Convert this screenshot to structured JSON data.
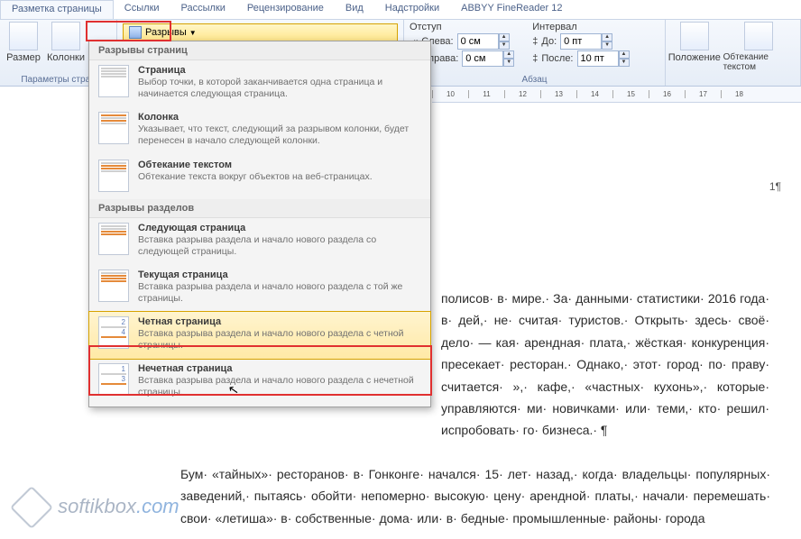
{
  "tabs": [
    "Разметка страницы",
    "Ссылки",
    "Рассылки",
    "Рецензирование",
    "Вид",
    "Надстройки",
    "ABBYY FineReader 12"
  ],
  "ribbon": {
    "size_label": "Размер",
    "columns_label": "Колонки",
    "page_params_label": "Параметры стран",
    "breaks_label": "Разрывы",
    "indent_title": "Отступ",
    "indent_left_label": "Слева:",
    "indent_right_label": "Справа:",
    "indent_left_val": "0 см",
    "indent_right_val": "0 см",
    "spacing_title": "Интервал",
    "spacing_before_label": "До:",
    "spacing_after_label": "После:",
    "spacing_before_val": "0 пт",
    "spacing_after_val": "10 пт",
    "paragraph_label": "Абзац",
    "position_label": "Положение",
    "wrap_label": "Обтекание текстом"
  },
  "menu": {
    "h1": "Разрывы страниц",
    "h2": "Разрывы разделов",
    "items_pages": [
      {
        "title": "Страница",
        "desc": "Выбор точки, в которой заканчивается одна страница и начинается следующая страница."
      },
      {
        "title": "Колонка",
        "desc": "Указывает, что текст, следующий за разрывом колонки, будет перенесен в начало следующей колонки."
      },
      {
        "title": "Обтекание текстом",
        "desc": "Обтекание текста вокруг объектов на веб-страницах."
      }
    ],
    "items_sections": [
      {
        "title": "Следующая страница",
        "desc": "Вставка разрыва раздела и начало нового раздела со следующей страницы."
      },
      {
        "title": "Текущая страница",
        "desc": "Вставка разрыва раздела и начало нового раздела с той же страницы."
      },
      {
        "title": "Четная страница",
        "desc": "Вставка разрыва раздела и начало нового раздела с четной страницы."
      },
      {
        "title": "Нечетная страница",
        "desc": "Вставка разрыва раздела и начало нового раздела с нечетной страницы."
      }
    ]
  },
  "ruler_vals": [
    "10",
    "11",
    "12",
    "13",
    "14",
    "15",
    "16",
    "17",
    "18"
  ],
  "doc_text": "полисов· в· мире.· За· данными· статистики· 2016 года· в· дей,· не· считая· туристов.· Открыть· здесь· своё· дело· — кая· арендная· плата,· жёсткая· конкуренция· пресекает· ресторан.· Однако,· этот· город· по· праву· считается· »,· кафе,· «частных· кухонь»,· которые· управляются· ми· новичками· или· теми,· кто· решил· испробовать· го· бизнеса.· ¶",
  "doc_text2": "Бум· «тайных»· ресторанов· в· Гонконге· начался· 15· лет· назад,· когда· владельцы· популярных· заведений,· пытаясь· обойти· непомерно· высокую· цену· арендной· платы,· начали· перемешать· свои· «летишa»· в· собственные· дома· или· в· бедные· промышленные· районы· города",
  "page_number": "1¶",
  "watermark": {
    "a": "softikbox",
    "b": ".com"
  }
}
